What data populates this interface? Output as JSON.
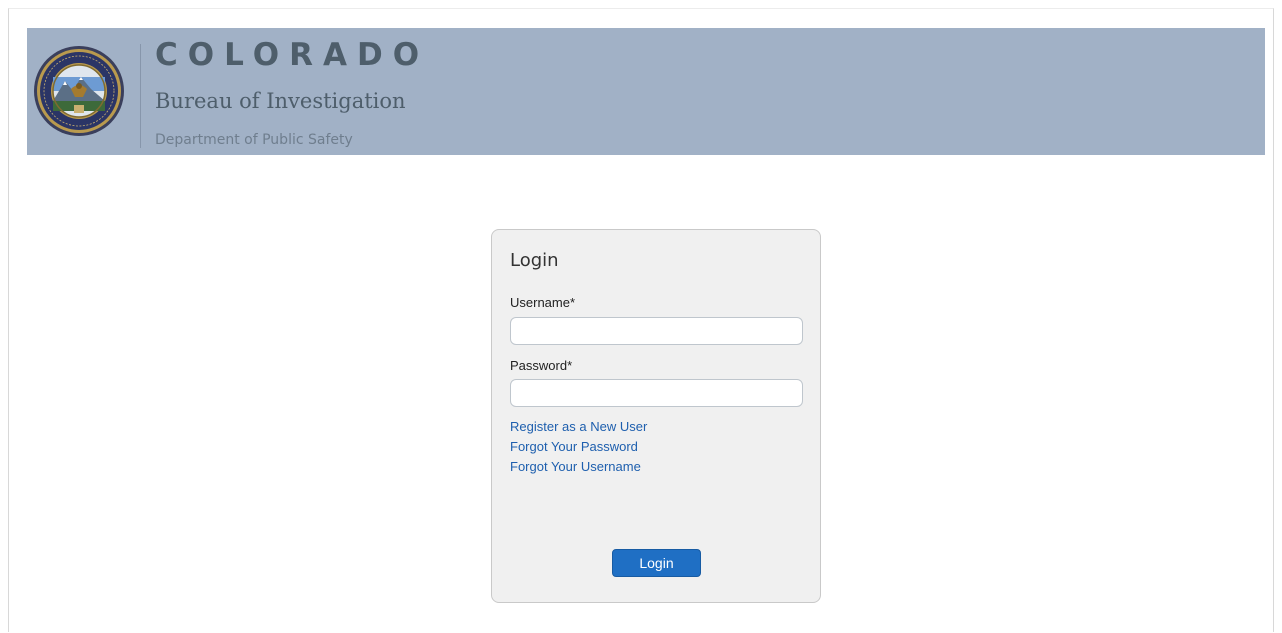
{
  "header": {
    "state_name": "COLORADO",
    "bureau_name": "Bureau of Investigation",
    "department_name": "Department of Public Safety",
    "seal_icon": "cbi-seal-icon",
    "background_color": "#a1b1c6"
  },
  "login": {
    "title": "Login",
    "username_label": "Username*",
    "username_value": "",
    "password_label": "Password*",
    "password_value": "",
    "links": {
      "register": "Register as a New User",
      "forgot_password": "Forgot Your Password",
      "forgot_username": "Forgot Your Username"
    },
    "submit_label": "Login",
    "accent_color": "#1f6fc4",
    "link_color": "#1e5fae"
  }
}
